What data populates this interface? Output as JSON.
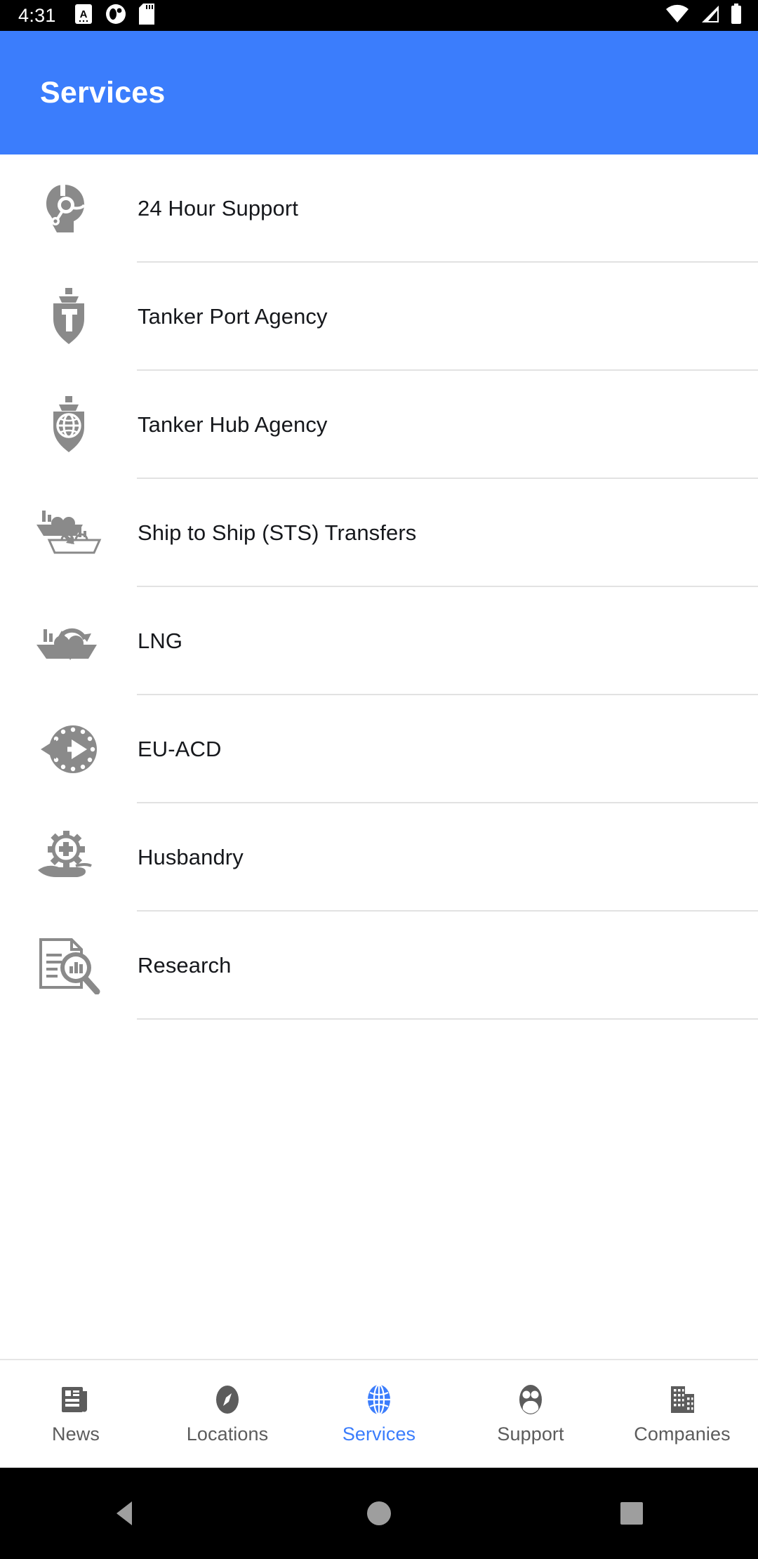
{
  "status_bar": {
    "time": "4:31",
    "left_icons": [
      "screenshot-icon",
      "app-notification-icon",
      "sd-card-icon"
    ],
    "right_icons": [
      "wifi-icon",
      "cellular-signal-icon",
      "battery-icon"
    ]
  },
  "app_bar": {
    "title": "Services",
    "background_color": "#3b7dfc",
    "title_color": "#ffffff"
  },
  "services": {
    "icon_color": "#8a8a8a",
    "divider_color": "#e2e2e2",
    "items": [
      {
        "label": "24 Hour Support",
        "icon": "support-headset-icon"
      },
      {
        "label": "Tanker Port Agency",
        "icon": "shield-tanker-t-icon"
      },
      {
        "label": "Tanker Hub Agency",
        "icon": "shield-globe-icon"
      },
      {
        "label": "Ship to Ship (STS) Transfers",
        "icon": "ship-to-ship-transfer-icon"
      },
      {
        "label": "LNG",
        "icon": "lng-tanker-cycle-icon"
      },
      {
        "label": "EU-ACD",
        "icon": "eu-stars-arrows-icon"
      },
      {
        "label": "Husbandry",
        "icon": "hand-gear-icon"
      },
      {
        "label": "Research",
        "icon": "document-magnifier-chart-icon"
      }
    ]
  },
  "bottom_nav": {
    "active_color": "#3b7dfc",
    "inactive_color": "#5c5c5c",
    "tabs": [
      {
        "label": "News",
        "icon": "newspaper-icon",
        "active": false
      },
      {
        "label": "Locations",
        "icon": "compass-icon",
        "active": false
      },
      {
        "label": "Services",
        "icon": "globe-icon",
        "active": true
      },
      {
        "label": "Support",
        "icon": "people-icon",
        "active": false
      },
      {
        "label": "Companies",
        "icon": "buildings-icon",
        "active": false
      }
    ]
  },
  "system_nav": {
    "buttons": [
      "back-triangle-icon",
      "home-circle-icon",
      "recents-square-icon"
    ]
  }
}
